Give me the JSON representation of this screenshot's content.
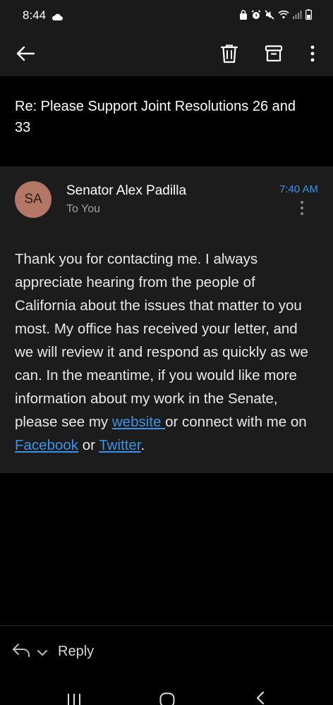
{
  "status_bar": {
    "time": "8:44"
  },
  "toolbar": {
    "back_icon": "arrow-left-icon",
    "delete_icon": "trash-icon",
    "archive_icon": "archive-icon",
    "more_icon": "more-vertical-icon"
  },
  "email": {
    "subject": "Re: Please Support Joint Resolutions 26 and 33",
    "avatar_initials": "SA",
    "avatar_color": "#b47766",
    "sender": "Senator Alex Padilla",
    "recipient": "To You",
    "time": "7:40 AM",
    "body_intro": "Thank you for contacting me. I always appreciate hearing from the people of California about the issues that matter to you most. My office has received your letter, and we will review it and respond as quickly as we can. In the meantime, if you would like more information about my work in the Senate, please see my ",
    "link_website": "website ",
    "body_mid": "or connect with me on ",
    "link_facebook": "Facebook",
    "body_or": " or ",
    "link_twitter": "Twitter",
    "body_end": "."
  },
  "reply_bar": {
    "label": "Reply"
  },
  "colors": {
    "link": "#3b94e8",
    "background": "#000000",
    "card": "#1c1c1c",
    "toolbar": "#1a1a1a"
  }
}
